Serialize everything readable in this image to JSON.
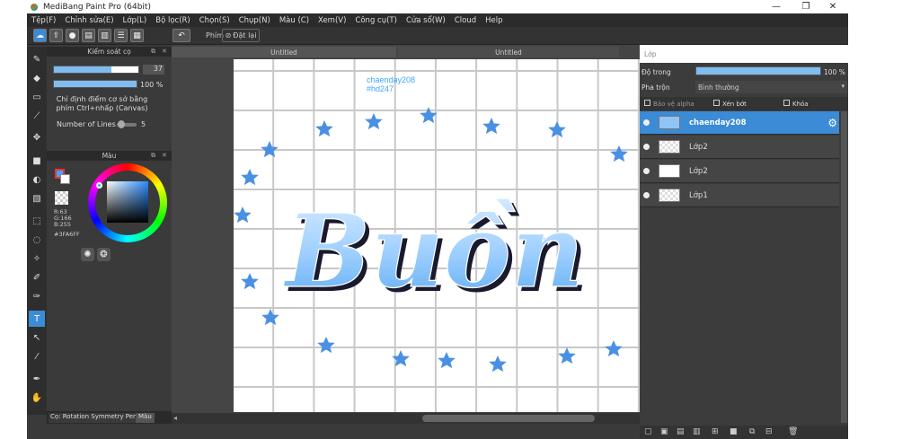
{
  "app": {
    "title": "MediBang Paint Pro (64bit)"
  },
  "window": {
    "min": "—",
    "restore": "❐",
    "close": "✕"
  },
  "menu": [
    "Tệp(F)",
    "Chỉnh sửa(E)",
    "Lớp(L)",
    "Bộ lọc(R)",
    "Chọn(S)",
    "Chụp(N)",
    "Màu (C)",
    "Xem(V)",
    "Công cụ(T)",
    "Cửa sổ(W)",
    "Cloud",
    "Help"
  ],
  "toolbar": {
    "key_label": "Phím",
    "reset_label": "Đặt lại"
  },
  "brush_panel": {
    "title": "Kiểm soát cọ",
    "size_value": "37",
    "opacity_value": "100 %",
    "size_fraction": 0.68,
    "opacity_fraction": 1.0,
    "hint_text": "Chỉ định điểm cơ sở bằng phím Ctrl+nhấp (Canvas)",
    "lines_label": "Number of Lines",
    "lines_value": "5"
  },
  "color_panel": {
    "title": "Màu",
    "r": "R:63",
    "g": "G:166",
    "b": "B:255",
    "hex": "#3FA6FF",
    "fg": "#3fa6ff",
    "bg": "#ffffff"
  },
  "bottom_tabs": {
    "brush_tab": "Cọ: Rotation Symmetry Pen",
    "color_tab": "Màu"
  },
  "doc_tabs": [
    "Untitled",
    "Untitled"
  ],
  "canvas": {
    "watermark_line1": "chaenday208",
    "watermark_line2": "#hd247",
    "main_text": "Buồn",
    "accent": "#3fa6ff"
  },
  "layer_panel": {
    "title": "Lớp",
    "opacity_label": "Độ trong",
    "opacity_value": "100 %",
    "opacity_fraction": 1.0,
    "blend_label": "Pha trộn",
    "blend_value": "Bình thường",
    "protect_alpha": "Bảo vệ alpha",
    "clipping": "Xén bớt",
    "lock": "Khóa",
    "layers": [
      {
        "name": "chaenday208",
        "selected": true
      },
      {
        "name": "Lớp2",
        "selected": false
      },
      {
        "name": "Lớp2",
        "selected": false
      },
      {
        "name": "Lớp1",
        "selected": false
      }
    ]
  }
}
